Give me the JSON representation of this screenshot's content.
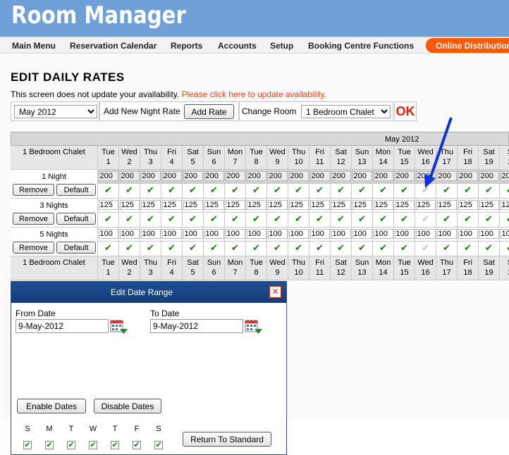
{
  "app": {
    "title": "Room Manager"
  },
  "nav": {
    "items": [
      "Main Menu",
      "Reservation Calendar",
      "Reports",
      "Accounts",
      "Setup",
      "Booking Centre Functions"
    ],
    "online": "Online Distribution"
  },
  "page": {
    "title": "EDIT DAILY RATES",
    "notice": "This screen does not update your availability. ",
    "notice_link": "Please click here to update availability."
  },
  "controls": {
    "month_value": "May 2012",
    "add_label": "Add New Night Rate",
    "add_button": "Add Rate",
    "change_label": "Change Room",
    "room_value": "1 Bedroom Chalet",
    "ok": "OK"
  },
  "grid": {
    "month": "May 2012",
    "room": "1 Bedroom Chalet",
    "days": [
      {
        "dow": "Tue",
        "num": "1"
      },
      {
        "dow": "Wed",
        "num": "2"
      },
      {
        "dow": "Thu",
        "num": "3"
      },
      {
        "dow": "Fri",
        "num": "4"
      },
      {
        "dow": "Sat",
        "num": "5"
      },
      {
        "dow": "Sun",
        "num": "6"
      },
      {
        "dow": "Mon",
        "num": "7"
      },
      {
        "dow": "Tue",
        "num": "8"
      },
      {
        "dow": "Wed",
        "num": "9"
      },
      {
        "dow": "Thu",
        "num": "10"
      },
      {
        "dow": "Fri",
        "num": "11"
      },
      {
        "dow": "Sat",
        "num": "12"
      },
      {
        "dow": "Sun",
        "num": "13"
      },
      {
        "dow": "Mon",
        "num": "14"
      },
      {
        "dow": "Tue",
        "num": "15"
      },
      {
        "dow": "Wed",
        "num": "16"
      },
      {
        "dow": "Thu",
        "num": "17"
      },
      {
        "dow": "Fri",
        "num": "18"
      },
      {
        "dow": "Sat",
        "num": "19"
      },
      {
        "dow": "S",
        "num": "2"
      }
    ],
    "rates": [
      {
        "label": "1 Night",
        "value": "200",
        "shaded": true,
        "faded_index": 15
      },
      {
        "label": "3 Nights",
        "value": "125",
        "shaded": false,
        "faded_index": 15
      },
      {
        "label": "5 Nights",
        "value": "100",
        "shaded": false,
        "faded_index": 15
      }
    ],
    "remove": "Remove",
    "default": "Default"
  },
  "dialog": {
    "title": "Edit Date Range",
    "close": "✕",
    "from_label": "From Date",
    "from_value": "9-May-2012",
    "to_label": "To Date",
    "to_value": "9-May-2012",
    "enable": "Enable Dates",
    "disable": "Disable Dates",
    "days": [
      "S",
      "M",
      "T",
      "W",
      "T",
      "F",
      "S"
    ],
    "return": "Return To Standard"
  }
}
